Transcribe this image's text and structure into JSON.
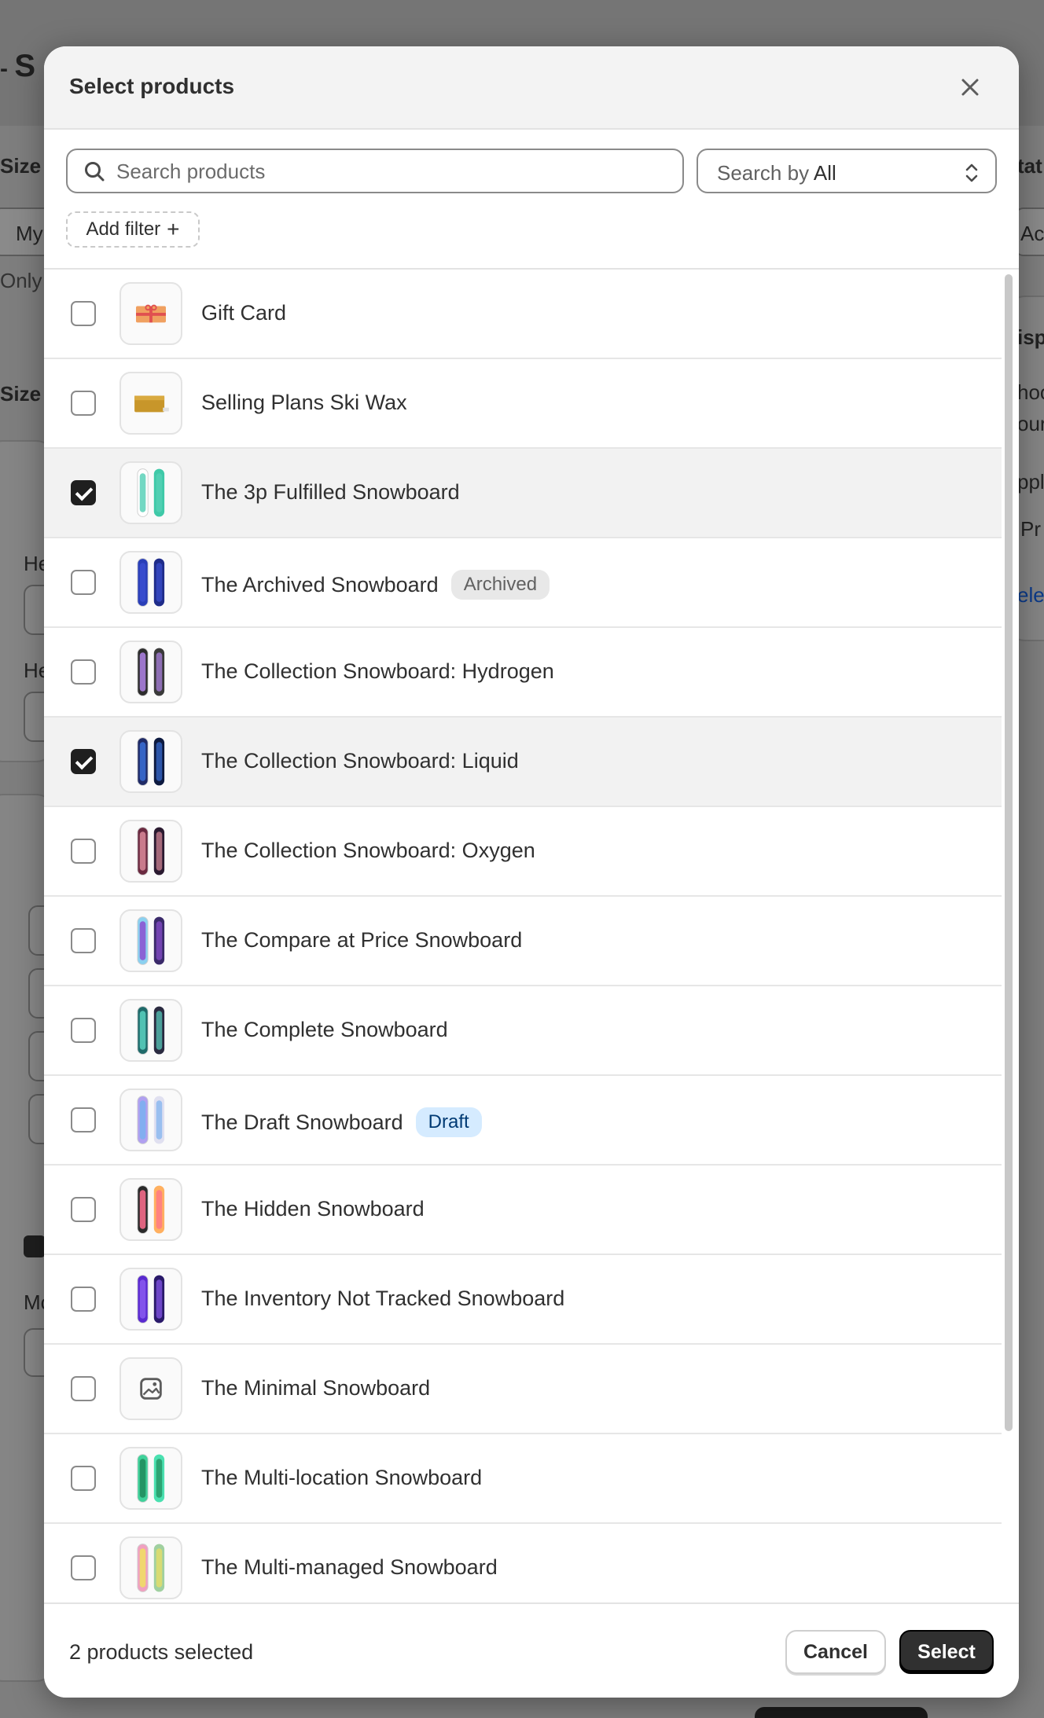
{
  "modal": {
    "title": "Select products",
    "search_placeholder": "Search products",
    "search_value": "",
    "search_by_prefix": "Search by",
    "search_by_value": "All",
    "add_filter_label": "Add filter",
    "products": [
      {
        "name": "Gift Card",
        "checked": false,
        "badge": "",
        "thumb": "gift-card-image"
      },
      {
        "name": "Selling Plans Ski Wax",
        "checked": false,
        "badge": "",
        "thumb": "ski-wax-image"
      },
      {
        "name": "The 3p Fulfilled Snowboard",
        "checked": true,
        "badge": "",
        "thumb": "snowboard-image"
      },
      {
        "name": "The Archived Snowboard",
        "checked": false,
        "badge": "Archived",
        "thumb": "snowboard-image"
      },
      {
        "name": "The Collection Snowboard: Hydrogen",
        "checked": false,
        "badge": "",
        "thumb": "snowboard-image"
      },
      {
        "name": "The Collection Snowboard: Liquid",
        "checked": true,
        "badge": "",
        "thumb": "snowboard-image"
      },
      {
        "name": "The Collection Snowboard: Oxygen",
        "checked": false,
        "badge": "",
        "thumb": "snowboard-image"
      },
      {
        "name": "The Compare at Price Snowboard",
        "checked": false,
        "badge": "",
        "thumb": "snowboard-image"
      },
      {
        "name": "The Complete Snowboard",
        "checked": false,
        "badge": "",
        "thumb": "snowboard-image"
      },
      {
        "name": "The Draft Snowboard",
        "checked": false,
        "badge": "Draft",
        "thumb": "snowboard-image"
      },
      {
        "name": "The Hidden Snowboard",
        "checked": false,
        "badge": "",
        "thumb": "snowboard-image"
      },
      {
        "name": "The Inventory Not Tracked Snowboard",
        "checked": false,
        "badge": "",
        "thumb": "snowboard-image"
      },
      {
        "name": "The Minimal Snowboard",
        "checked": false,
        "badge": "",
        "thumb": "image-placeholder-icon"
      },
      {
        "name": "The Multi-location Snowboard",
        "checked": false,
        "badge": "",
        "thumb": "snowboard-image"
      },
      {
        "name": "The Multi-managed Snowboard",
        "checked": false,
        "badge": "",
        "thumb": "snowboard-image"
      }
    ],
    "footer": {
      "selected_count_text": "2 products selected",
      "cancel_label": "Cancel",
      "select_label": "Select"
    }
  },
  "background": {
    "page_title": "S",
    "texts": [
      "Size",
      "My",
      "Only",
      "Size",
      "He",
      "He",
      "Mc",
      "tat",
      "Ac",
      "isp",
      "hoo",
      "our",
      "ppl",
      "Pr",
      "ele"
    ]
  },
  "colors": {
    "primary_button": "#303030",
    "draft_badge_bg": "#d5ebff",
    "archived_badge_bg": "#e8e8e8",
    "checkbox_checked": "#1f1f1f"
  }
}
